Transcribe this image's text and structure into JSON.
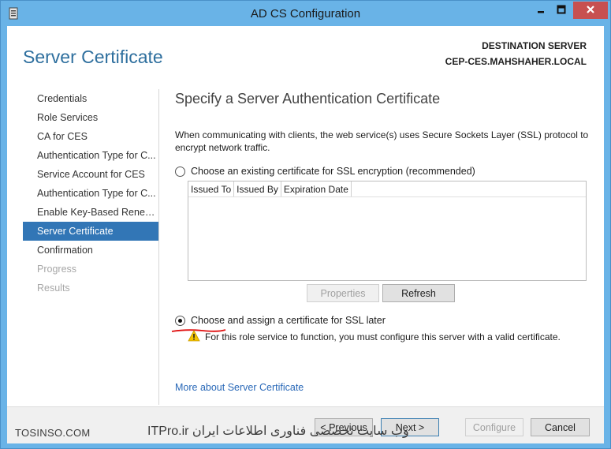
{
  "window": {
    "title": "AD CS Configuration",
    "icons": {
      "app": "server-manager-icon",
      "minimize": "minimize-icon",
      "maximize": "maximize-icon",
      "close": "close-icon"
    }
  },
  "page": {
    "title": "Server Certificate",
    "destination_label": "DESTINATION SERVER",
    "destination_value": "CEP-CES.MAHSHAHER.LOCAL"
  },
  "nav": {
    "items": [
      {
        "label": "Credentials",
        "state": "normal"
      },
      {
        "label": "Role Services",
        "state": "normal"
      },
      {
        "label": "CA for CES",
        "state": "normal"
      },
      {
        "label": "Authentication Type for C...",
        "state": "normal"
      },
      {
        "label": "Service Account for CES",
        "state": "normal"
      },
      {
        "label": "Authentication Type for C...",
        "state": "normal"
      },
      {
        "label": "Enable Key-Based Renew...",
        "state": "normal"
      },
      {
        "label": "Server Certificate",
        "state": "selected"
      },
      {
        "label": "Confirmation",
        "state": "normal"
      },
      {
        "label": "Progress",
        "state": "disabled"
      },
      {
        "label": "Results",
        "state": "disabled"
      }
    ]
  },
  "content": {
    "heading": "Specify a Server Authentication Certificate",
    "description": "When communicating with clients, the web service(s) uses Secure Sockets Layer (SSL) protocol to encrypt network traffic.",
    "option_existing": "Choose an existing certificate for SSL encryption (recommended)",
    "table_columns": [
      "Issued To",
      "Issued By",
      "Expiration Date"
    ],
    "properties_label": "Properties",
    "refresh_label": "Refresh",
    "option_later": "Choose and assign a certificate for SSL later",
    "warning_text": "For this role service to function, you must configure this server with a valid certificate.",
    "more_link": "More about Server Certificate"
  },
  "footer": {
    "previous_label": "< Previous",
    "next_label": "Next >",
    "configure_label": "Configure",
    "cancel_label": "Cancel",
    "watermark_left": "TOSINSO.COM",
    "watermark_center": "وب سایت تخصصی فناوری اطلاعات ایران ITPro.ir"
  },
  "colors": {
    "accent": "#3276b6",
    "title_blue": "#2e6f9e",
    "link": "#2a69b8",
    "frame": "#69b3e7"
  }
}
